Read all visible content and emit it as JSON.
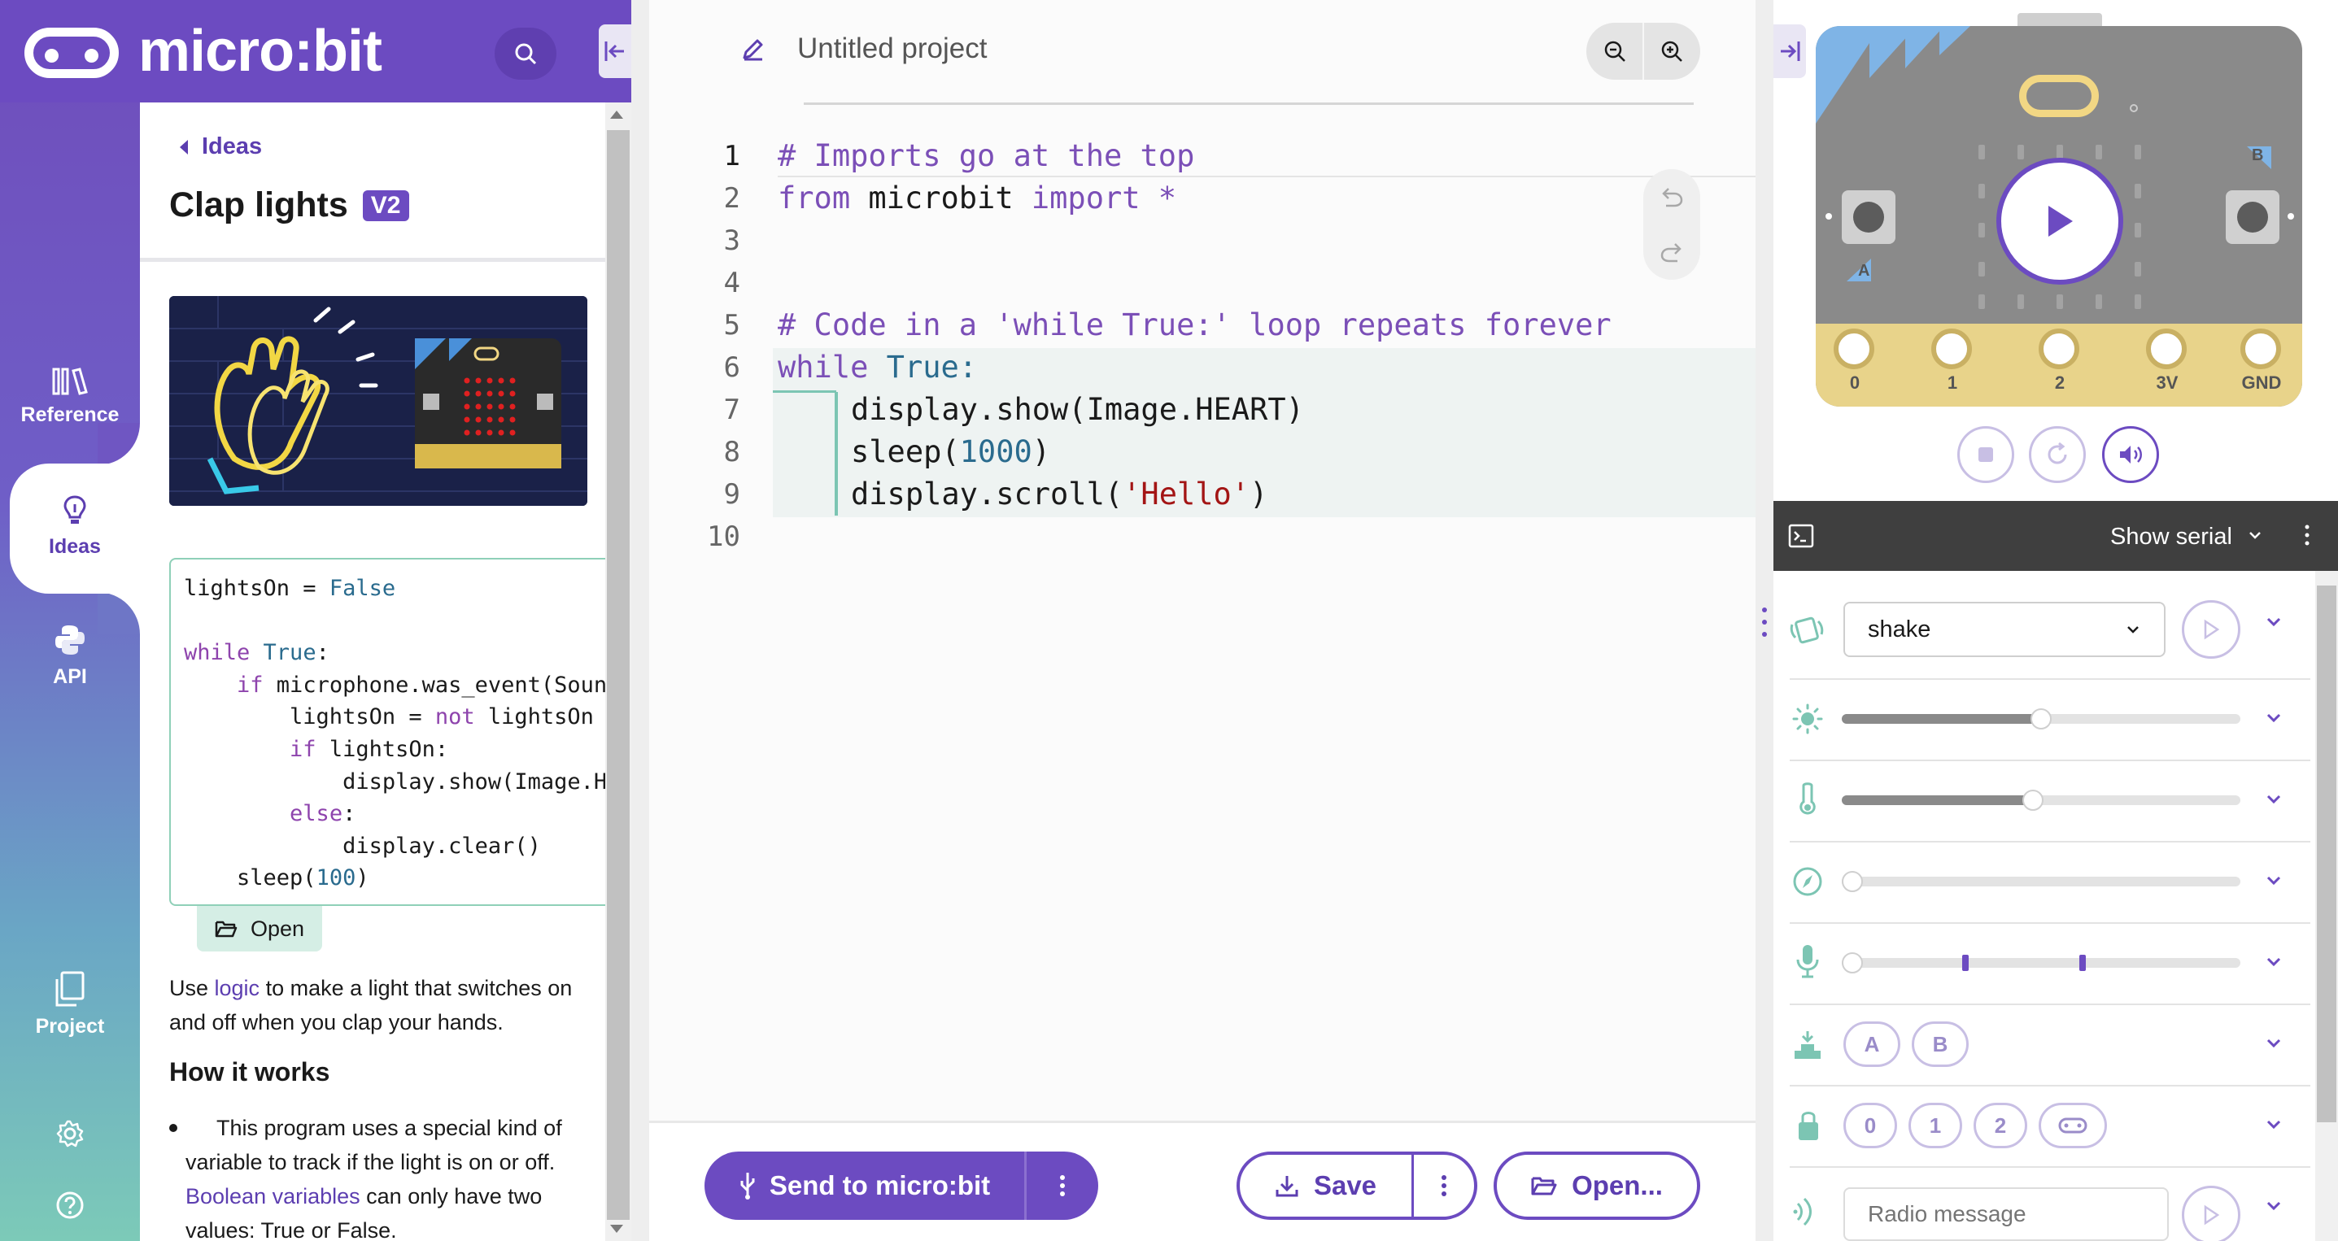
{
  "app": {
    "logo_text": "micro:bit"
  },
  "nav": {
    "items": [
      {
        "label": "Reference"
      },
      {
        "label": "Ideas"
      },
      {
        "label": "API"
      },
      {
        "label": "Project"
      }
    ]
  },
  "ideas": {
    "back_label": "Ideas",
    "title": "Clap lights",
    "badge": "V2",
    "code_lines": [
      "lightsOn = False",
      "",
      "while True:",
      "    if microphone.was_event(SoundEvent.LOUD):",
      "        lightsOn = not lightsOn",
      "        if lightsOn:",
      "            display.show(Image.HEART)",
      "        else:",
      "            display.clear()",
      "    sleep(100)"
    ],
    "open_label": "Open",
    "desc_pre": "Use ",
    "desc_link": "logic",
    "desc_post": " to make a light that switches on and off when you clap your hands.",
    "how_heading": "How it works",
    "bullet_pre": "This program uses a special kind of variable to track if the light is on or off. ",
    "bullet_link": "Boolean variables",
    "bullet_post": " can only have two values: True or False."
  },
  "editor": {
    "project_name": "Untitled project",
    "line_numbers": [
      "1",
      "2",
      "3",
      "4",
      "5",
      "6",
      "7",
      "8",
      "9",
      "10"
    ],
    "lines": {
      "l1": "# Imports go at the top",
      "l2_kw1": "from",
      "l2_mod": " microbit ",
      "l2_kw2": "import",
      "l2_star": " *",
      "l5": "# Code in a 'while True:' loop repeats forever",
      "l6_kw": "while",
      "l6_rest": " True:",
      "l7": "display.show(Image.HEART)",
      "l8_pre": "sleep(",
      "l8_num": "1000",
      "l8_post": ")",
      "l9_pre": "display.scroll(",
      "l9_str": "'Hello'",
      "l9_post": ")"
    },
    "send_label": "Send to micro:bit",
    "save_label": "Save",
    "open_label": "Open..."
  },
  "simulator": {
    "pins": [
      "0",
      "1",
      "2",
      "3V",
      "GND"
    ],
    "button_a": "A",
    "button_b": "B",
    "serial_label": "Show serial",
    "gesture_value": "shake",
    "buttons": [
      "A",
      "B"
    ],
    "touch_pins": [
      "0",
      "1",
      "2"
    ],
    "radio_placeholder": "Radio message",
    "light_level": 0.5,
    "temperature_level": 0.48,
    "compass_level": 0.0,
    "sound_level": 0.0
  },
  "colors": {
    "brand_purple": "#6c4bc1",
    "accent_teal": "#7cc5b3",
    "pin_gold": "#e8d38a"
  }
}
